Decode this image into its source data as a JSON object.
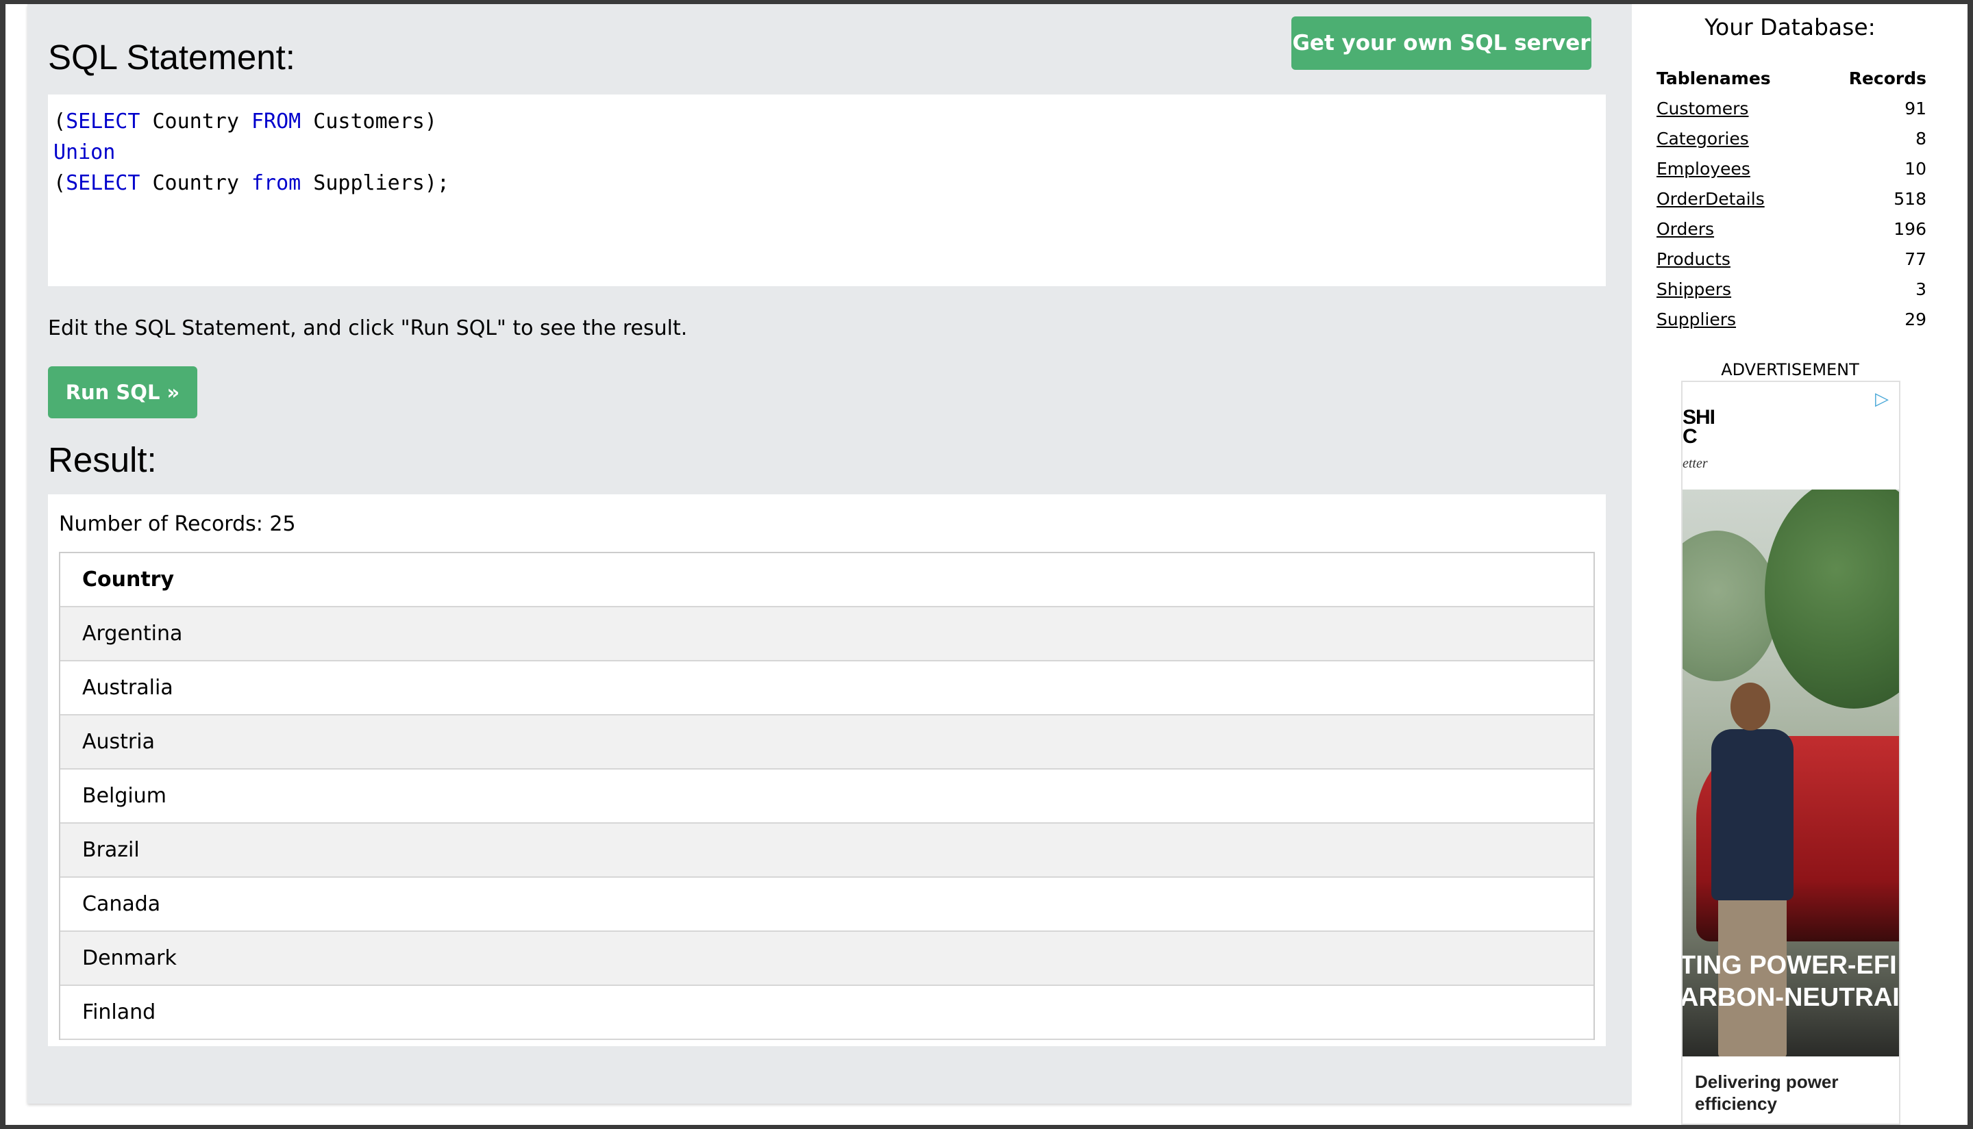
{
  "editor_panel": {
    "title": "SQL Statement:",
    "own_server_button": "Get your own SQL server",
    "sql_lines": [
      [
        {
          "t": "(",
          "k": false
        },
        {
          "t": "SELECT",
          "k": true
        },
        {
          "t": " Country ",
          "k": false
        },
        {
          "t": "FROM",
          "k": true
        },
        {
          "t": " Customers)",
          "k": false
        }
      ],
      [
        {
          "t": "Union",
          "k": true
        }
      ],
      [
        {
          "t": "(",
          "k": false
        },
        {
          "t": "SELECT",
          "k": true
        },
        {
          "t": " Country ",
          "k": false
        },
        {
          "t": "from",
          "k": true
        },
        {
          "t": " Suppliers);",
          "k": false
        }
      ]
    ],
    "hint": "Edit the SQL Statement, and click \"Run SQL\" to see the result.",
    "run_button": "Run SQL »"
  },
  "result": {
    "title": "Result:",
    "record_count": "Number of Records: 25",
    "column_header": "Country",
    "rows": [
      "Argentina",
      "Australia",
      "Austria",
      "Belgium",
      "Brazil",
      "Canada",
      "Denmark",
      "Finland"
    ]
  },
  "database": {
    "title": "Your Database:",
    "col_tablenames": "Tablenames",
    "col_records": "Records",
    "tables": [
      {
        "name": "Customers",
        "records": "91"
      },
      {
        "name": "Categories",
        "records": "8"
      },
      {
        "name": "Employees",
        "records": "10"
      },
      {
        "name": "OrderDetails",
        "records": "518"
      },
      {
        "name": "Orders",
        "records": "196"
      },
      {
        "name": "Products",
        "records": "77"
      },
      {
        "name": "Shippers",
        "records": "3"
      },
      {
        "name": "Suppliers",
        "records": "29"
      }
    ]
  },
  "ad": {
    "label": "ADVERTISEMENT",
    "brand_line1": "SHI",
    "brand_line2": "C",
    "brand_sub": "etter",
    "headline_line1": "TING POWER-EFI",
    "headline_line2": "ARBON-NEUTRAI",
    "footer": "Delivering power efficiency",
    "chip_icon": "adchoices-icon"
  },
  "colors": {
    "accent_green": "#4caf72",
    "keyword_blue": "#0000cc",
    "panel_gray": "#e7e9eb"
  }
}
